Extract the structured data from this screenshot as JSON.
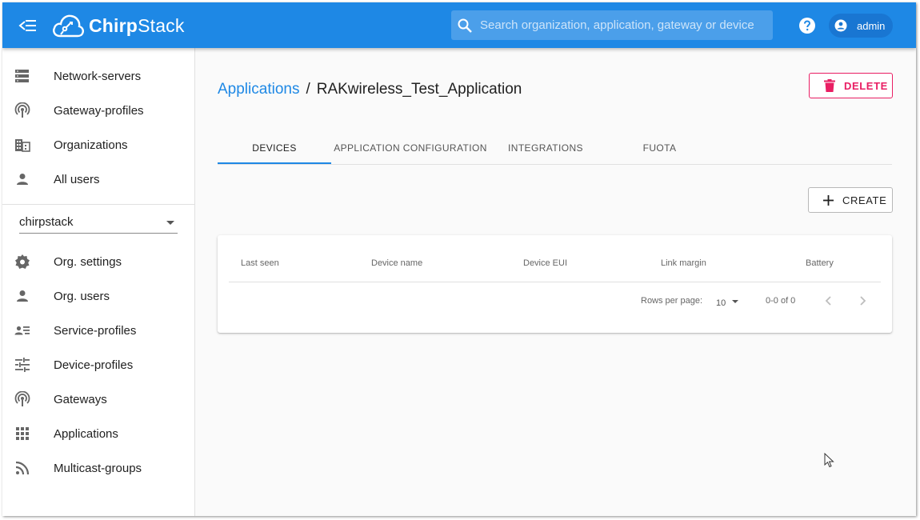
{
  "header": {
    "brand_bold": "Chirp",
    "brand_rest": "Stack",
    "search_placeholder": "Search organization, application, gateway or device",
    "user_label": "admin",
    "icons": [
      "menu-collapse-icon",
      "chirpstack-logo",
      "search-icon",
      "help-icon",
      "account-circle-icon"
    ],
    "primary_color": "#1e88e5"
  },
  "sidebar": {
    "admin_items": [
      {
        "label": "Network-servers",
        "icon": "server-icon"
      },
      {
        "label": "Gateway-profiles",
        "icon": "antenna-icon"
      },
      {
        "label": "Organizations",
        "icon": "domain-icon"
      },
      {
        "label": "All users",
        "icon": "person-icon"
      }
    ],
    "org_selector": "chirpstack",
    "org_items": [
      {
        "label": "Org. settings",
        "icon": "settings-icon"
      },
      {
        "label": "Org. users",
        "icon": "person-icon"
      },
      {
        "label": "Service-profiles",
        "icon": "account-details-icon"
      },
      {
        "label": "Device-profiles",
        "icon": "tune-icon"
      },
      {
        "label": "Gateways",
        "icon": "antenna-icon"
      },
      {
        "label": "Applications",
        "icon": "apps-icon"
      },
      {
        "label": "Multicast-groups",
        "icon": "rss-icon"
      }
    ]
  },
  "main": {
    "breadcrumb": {
      "parent": "Applications",
      "separator": "/",
      "current": "RAKwireless_Test_Application"
    },
    "delete_label": "DELETE",
    "delete_color": "#e91e63",
    "tabs": [
      {
        "label": "DEVICES",
        "active": true
      },
      {
        "label": "APPLICATION CONFIGURATION",
        "active": false
      },
      {
        "label": "INTEGRATIONS",
        "active": false
      },
      {
        "label": "FUOTA",
        "active": false
      }
    ],
    "create_label": "CREATE",
    "table": {
      "columns": [
        "Last seen",
        "Device name",
        "Device EUI",
        "Link margin",
        "Battery"
      ],
      "rows": [],
      "rows_per_page_label": "Rows per page:",
      "rows_per_page": "10",
      "range": "0-0 of 0"
    }
  }
}
